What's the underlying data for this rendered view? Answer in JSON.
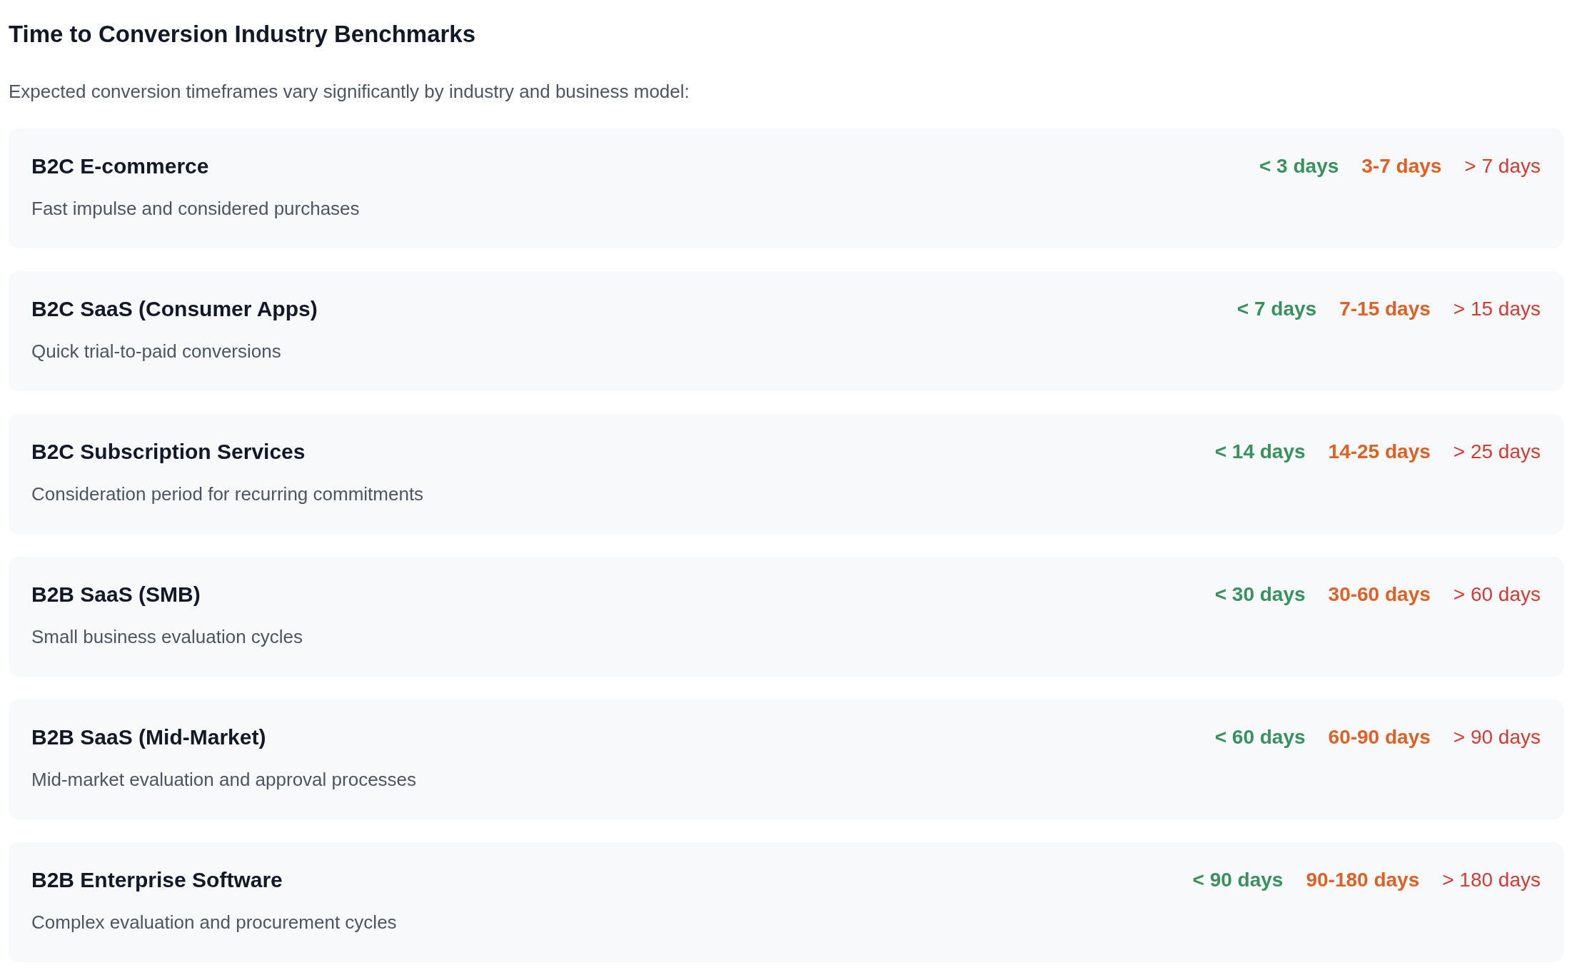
{
  "title": "Time to Conversion Industry Benchmarks",
  "intro": "Expected conversion timeframes vary significantly by industry and business model:",
  "benchmarks": [
    {
      "name": "B2C E-commerce",
      "description": "Fast impulse and considered purchases",
      "ranges": [
        {
          "kind": "good",
          "label": "< 3 days"
        },
        {
          "kind": "average",
          "label": "3-7 days"
        },
        {
          "kind": "slow",
          "label": "> 7 days"
        }
      ]
    },
    {
      "name": "B2C SaaS (Consumer Apps)",
      "description": "Quick trial-to-paid conversions",
      "ranges": [
        {
          "kind": "good",
          "label": "< 7 days"
        },
        {
          "kind": "average",
          "label": "7-15 days"
        },
        {
          "kind": "slow",
          "label": "> 15 days"
        }
      ]
    },
    {
      "name": "B2C Subscription Services",
      "description": "Consideration period for recurring commitments",
      "ranges": [
        {
          "kind": "good",
          "label": "< 14 days"
        },
        {
          "kind": "average",
          "label": "14-25 days"
        },
        {
          "kind": "slow",
          "label": "> 25 days"
        }
      ]
    },
    {
      "name": "B2B SaaS (SMB)",
      "description": "Small business evaluation cycles",
      "ranges": [
        {
          "kind": "good",
          "label": "< 30 days"
        },
        {
          "kind": "average",
          "label": "30-60 days"
        },
        {
          "kind": "slow",
          "label": "> 60 days"
        }
      ]
    },
    {
      "name": "B2B SaaS (Mid-Market)",
      "description": "Mid-market evaluation and approval processes",
      "ranges": [
        {
          "kind": "good",
          "label": "< 60 days"
        },
        {
          "kind": "average",
          "label": "60-90 days"
        },
        {
          "kind": "slow",
          "label": "> 90 days"
        }
      ]
    },
    {
      "name": "B2B Enterprise Software",
      "description": "Complex evaluation and procurement cycles",
      "ranges": [
        {
          "kind": "good",
          "label": "< 90 days"
        },
        {
          "kind": "average",
          "label": "90-180 days"
        },
        {
          "kind": "slow",
          "label": "> 180 days"
        }
      ]
    }
  ]
}
